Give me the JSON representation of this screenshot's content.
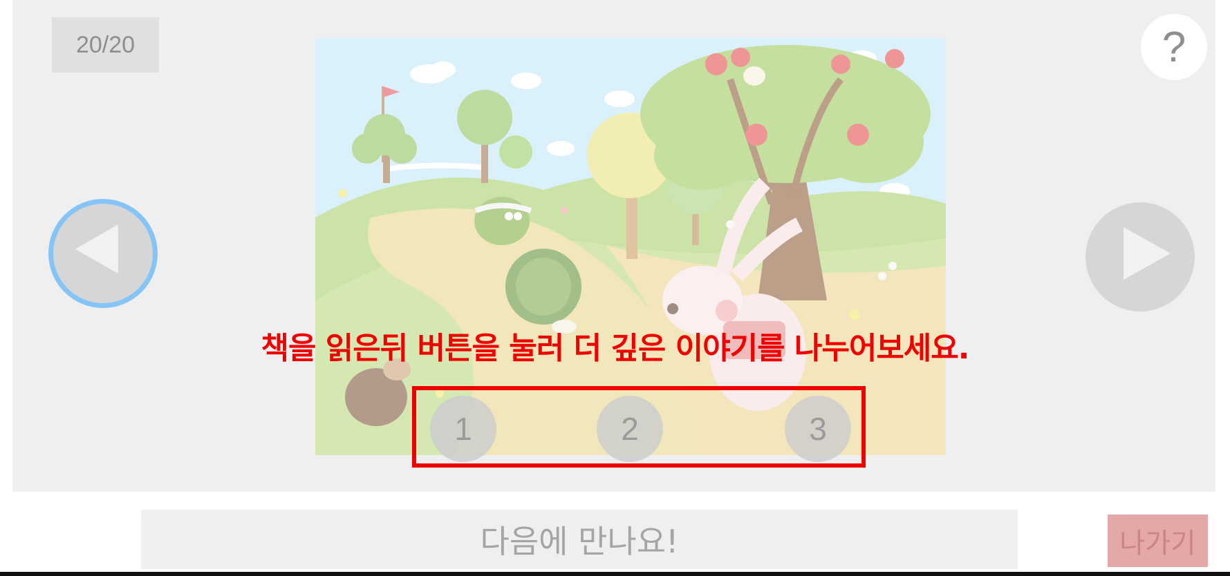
{
  "header": {
    "page_counter": "20/20",
    "help_label": "?"
  },
  "illustration": {
    "scene": "tortoise-and-hare-race"
  },
  "instruction": {
    "text": "책을 읽은뒤 버튼을 눌러 더 깊은 이야기를 나누어보세요."
  },
  "choices": [
    {
      "label": "1"
    },
    {
      "label": "2"
    },
    {
      "label": "3"
    }
  ],
  "footer": {
    "message": "다음에 만나요!",
    "exit_label": "나가기"
  },
  "icons": {
    "prev": "triangle-left-icon",
    "next": "triangle-right-icon"
  },
  "colors": {
    "instruction": "#f00000",
    "highlight_border": "#ee0000",
    "prev_focus_ring": "#84c4f6",
    "exit_button": "#e5a8a8"
  }
}
